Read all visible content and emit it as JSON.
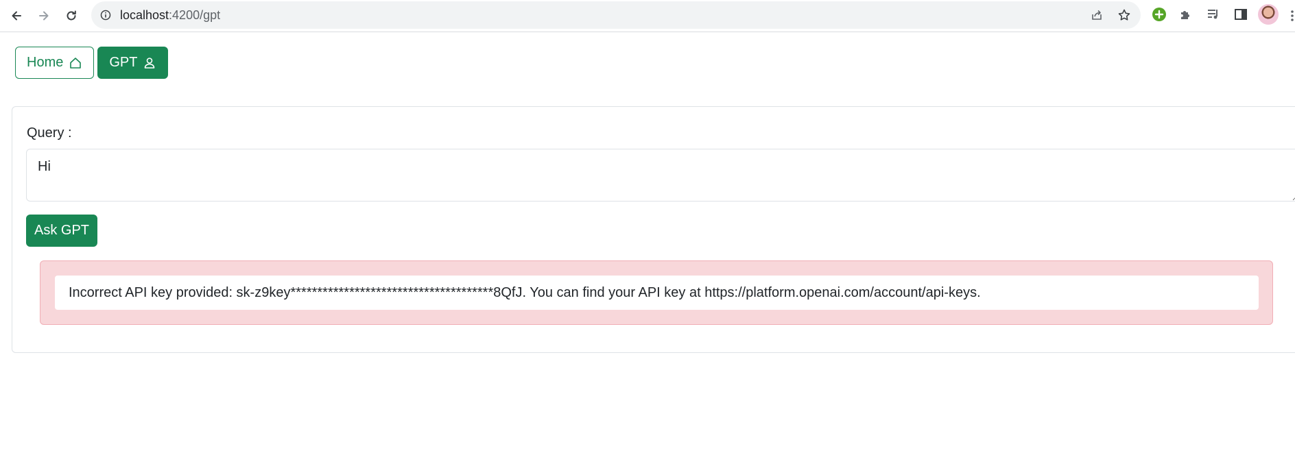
{
  "browser": {
    "url_host": "localhost",
    "url_path": ":4200/gpt",
    "icons": {
      "back": "arrow-left-icon",
      "forward": "arrow-right-icon",
      "reload": "reload-icon",
      "site_info": "info-icon",
      "share": "share-icon",
      "bookmark": "star-icon",
      "extension_green": "plus-circle-icon",
      "extensions": "puzzle-icon",
      "media": "media-queue-icon",
      "side_panel": "side-panel-icon",
      "profile": "avatar"
    }
  },
  "nav": {
    "home_label": "Home",
    "gpt_label": "GPT"
  },
  "form": {
    "query_label": "Query :",
    "query_value": "Hi",
    "ask_label": "Ask GPT"
  },
  "alert": {
    "message": "Incorrect API key provided: sk-z9key**************************************8QfJ. You can find your API key at https://platform.openai.com/account/api-keys."
  },
  "colors": {
    "primary": "#198754",
    "alert_bg": "#f8d7da",
    "alert_border": "#f1aeb5"
  }
}
